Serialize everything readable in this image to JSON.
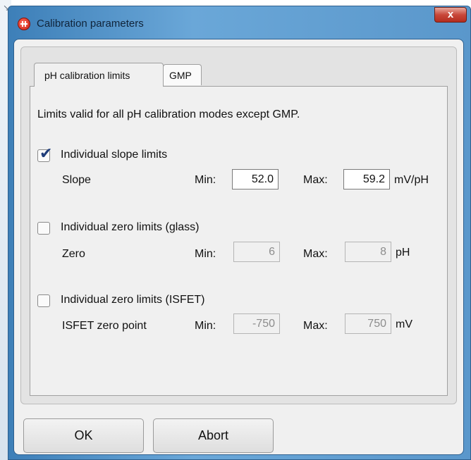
{
  "window": {
    "title": "Calibration parameters",
    "close_label": "x"
  },
  "tabs": [
    {
      "label": "pH calibration limits",
      "active": true
    },
    {
      "label": "GMP",
      "active": false
    }
  ],
  "page": {
    "intro": "Limits valid for all pH calibration modes except GMP.",
    "groups": [
      {
        "checkbox_label": "Individual slope limits",
        "checked": true,
        "row_label": "Slope",
        "min_label": "Min:",
        "min_value": "52.0",
        "max_label": "Max:",
        "max_value": "59.2",
        "unit": "mV/pH",
        "enabled": true
      },
      {
        "checkbox_label": "Individual zero limits (glass)",
        "checked": false,
        "row_label": "Zero",
        "min_label": "Min:",
        "min_value": "6",
        "max_label": "Max:",
        "max_value": "8",
        "unit": "pH",
        "enabled": false
      },
      {
        "checkbox_label": "Individual zero limits (ISFET)",
        "checked": false,
        "row_label": "ISFET zero point",
        "min_label": "Min:",
        "min_value": "-750",
        "max_label": "Max:",
        "max_value": "750",
        "unit": "mV",
        "enabled": false
      }
    ]
  },
  "buttons": {
    "ok": "OK",
    "abort": "Abort"
  },
  "icons": {
    "app": "calibration-app-icon",
    "close": "close-icon",
    "check": "checkmark-icon"
  },
  "colors": {
    "title_bar": "#5a97cb",
    "close_button": "#c8483a",
    "check": "#1f3d7a"
  }
}
